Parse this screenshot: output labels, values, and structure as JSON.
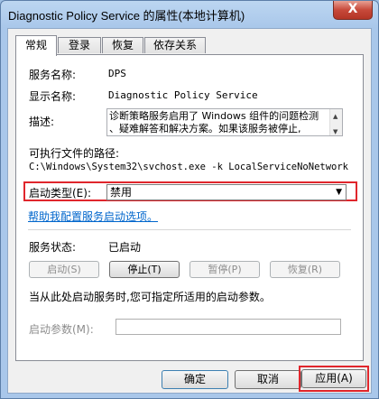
{
  "window": {
    "title": "Diagnostic Policy Service 的属性(本地计算机)",
    "close_glyph": "X"
  },
  "tabs": [
    {
      "label": "常规",
      "active": true
    },
    {
      "label": "登录",
      "active": false
    },
    {
      "label": "恢复",
      "active": false
    },
    {
      "label": "依存关系",
      "active": false
    }
  ],
  "general": {
    "service_name_label": "服务名称:",
    "service_name_value": "DPS",
    "display_name_label": "显示名称:",
    "display_name_value": "Diagnostic Policy Service",
    "description_label": "描述:",
    "description_line1": "诊断策略服务启用了 Windows 组件的问题检测",
    "description_line2": "、疑难解答和解决方案。如果该服务被停止,",
    "exe_path_label": "可执行文件的路径:",
    "exe_path_value": "C:\\Windows\\System32\\svchost.exe -k LocalServiceNoNetwork",
    "startup_type_label": "启动类型(E):",
    "startup_type_value": "禁用",
    "help_link": "帮助我配置服务启动选项。",
    "service_status_label": "服务状态:",
    "service_status_value": "已启动",
    "buttons": {
      "start": "启动(S)",
      "stop": "停止(T)",
      "pause": "暂停(P)",
      "resume": "恢复(R)"
    },
    "start_params_hint": "当从此处启动服务时,您可指定所适用的启动参数。",
    "start_params_label": "启动参数(M):",
    "start_params_value": ""
  },
  "footer": {
    "ok": "确定",
    "cancel": "取消",
    "apply": "应用(A)"
  },
  "colors": {
    "highlight": "#e0262c",
    "link": "#0066cc"
  }
}
